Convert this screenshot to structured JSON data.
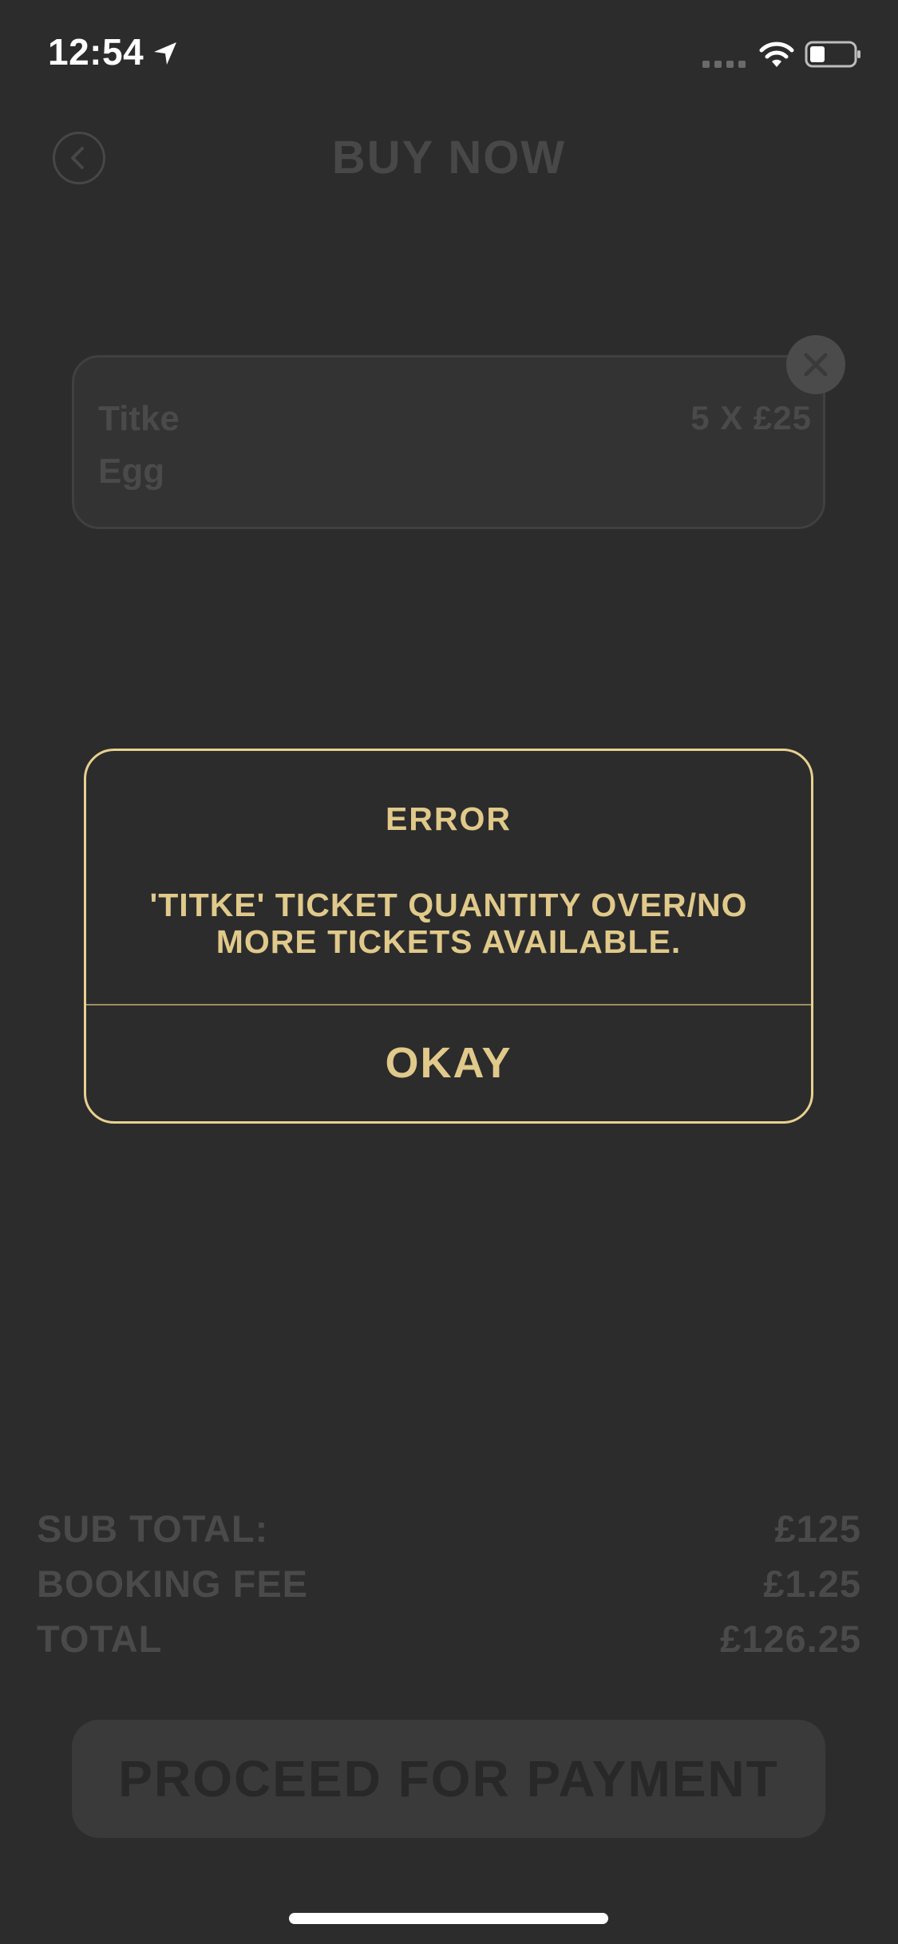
{
  "status_bar": {
    "time": "12:54",
    "icons": [
      "location-arrow-icon",
      "cellular-signal-icon",
      "wifi-icon",
      "battery-icon"
    ]
  },
  "header": {
    "title": "BUY NOW",
    "back_icon": "chevron-left-icon"
  },
  "ticket": {
    "name": "Titke",
    "subname": "Egg",
    "qty_price": "5 X £25",
    "remove_icon": "close-icon"
  },
  "totals": {
    "subtotal_label": "SUB TOTAL:",
    "subtotal_value": "£125",
    "booking_fee_label": "BOOKING FEE",
    "booking_fee_value": "£1.25",
    "total_label": "TOTAL",
    "total_value": "£126.25"
  },
  "proceed_button": {
    "label": "PROCEED FOR PAYMENT"
  },
  "dialog": {
    "title": "ERROR",
    "message": "'TITKE' TICKET QUANTITY OVER/NO MORE TICKETS AVAILABLE.",
    "okay_label": "OKAY"
  },
  "colors": {
    "background": "#2c2c2c",
    "accent_gold": "#e0c98a",
    "dialog_border": "#e7d190",
    "dimmed_text": "#4a4a4a"
  }
}
